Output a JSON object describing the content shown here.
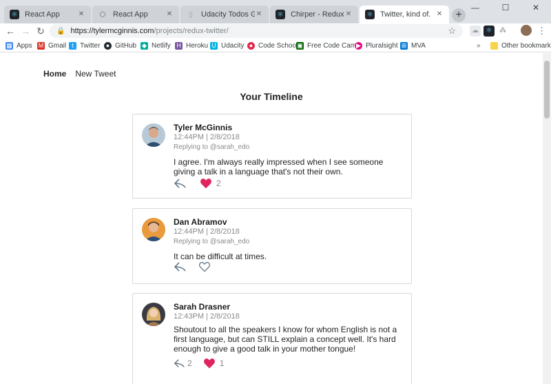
{
  "browser": {
    "tabs": [
      {
        "label": "React App",
        "icon": "react-icon",
        "active": false
      },
      {
        "label": "React App",
        "icon": "box-icon",
        "active": false
      },
      {
        "label": "Udacity Todos Goals",
        "icon": "document-icon",
        "active": false
      },
      {
        "label": "Chirper - Redux Twitter",
        "icon": "react-icon",
        "active": false
      },
      {
        "label": "Twitter, kind of.",
        "icon": "react-icon",
        "active": true
      }
    ],
    "url_host": "https://tylermcginnis.com",
    "url_path": "/projects/redux-twitter/",
    "bookmarks": [
      {
        "label": "Apps",
        "icon": "apps-grid-icon",
        "color": "#4285f4"
      },
      {
        "label": "Gmail",
        "icon": "gmail-icon",
        "color": "#d93025"
      },
      {
        "label": "Twitter",
        "icon": "twitter-icon",
        "color": "#1da1f2"
      },
      {
        "label": "GitHub",
        "icon": "github-icon",
        "color": "#24292e"
      },
      {
        "label": "Netlify",
        "icon": "netlify-icon",
        "color": "#00ad9f"
      },
      {
        "label": "Heroku",
        "icon": "heroku-icon",
        "color": "#79589f"
      },
      {
        "label": "Udacity",
        "icon": "udacity-icon",
        "color": "#02b3e4"
      },
      {
        "label": "Code School",
        "icon": "codeschool-icon",
        "color": "#e2264b"
      },
      {
        "label": "Free Code Camp",
        "icon": "freecodecamp-icon",
        "color": "#006400"
      },
      {
        "label": "Pluralsight",
        "icon": "pluralsight-icon",
        "color": "#e80a89"
      },
      {
        "label": "MVA",
        "icon": "windows-icon",
        "color": "#0078d7"
      }
    ],
    "other_bookmarks": "Other bookmarks",
    "more_bookmarks": "»"
  },
  "app": {
    "nav": {
      "home": "Home",
      "new_tweet": "New Tweet"
    },
    "title": "Your Timeline",
    "colors": {
      "heart": "#e0245e",
      "icon": "#657786",
      "text": "#232323"
    },
    "tweets": [
      {
        "author": "Tyler McGinnis",
        "timestamp": "12:44PM | 2/8/2018",
        "replying": "Replying to @sarah_edo",
        "text": "I agree. I'm always really impressed when I see someone giving a talk in a language that's not their own.",
        "likes": "2",
        "replies": "",
        "liked": true
      },
      {
        "author": "Dan Abramov",
        "timestamp": "12:44PM | 2/8/2018",
        "replying": "Replying to @sarah_edo",
        "text": "It can be difficult at times.",
        "likes": "",
        "replies": "",
        "liked": false
      },
      {
        "author": "Sarah Drasner",
        "timestamp": "12:43PM | 2/8/2018",
        "replying": "",
        "text": "Shoutout to all the speakers I know for whom English is not a first language, but can STILL explain a concept well. It's hard enough to give a good talk in your mother tongue!",
        "likes": "1",
        "replies": "2",
        "liked": true
      }
    ]
  }
}
